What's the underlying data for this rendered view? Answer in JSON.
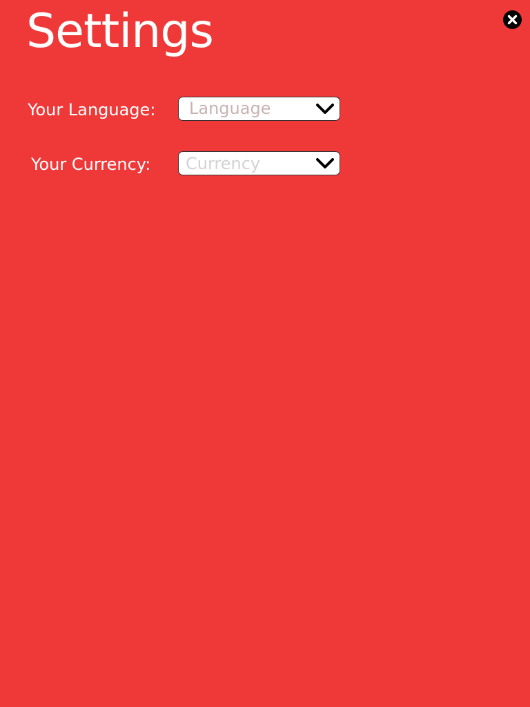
{
  "page": {
    "title": "Settings"
  },
  "settings": {
    "language": {
      "label": "Your Language:",
      "placeholder": "Language"
    },
    "currency": {
      "label": "Your Currency:",
      "placeholder": "Currency"
    }
  },
  "colors": {
    "background": "#ef3939",
    "text": "#ffffff",
    "language_placeholder": "#c9b3b3",
    "currency_placeholder": "#d3d3d3",
    "close_button": "#000000"
  },
  "icons": {
    "close": "close-icon",
    "dropdown": "chevron-down-icon"
  }
}
